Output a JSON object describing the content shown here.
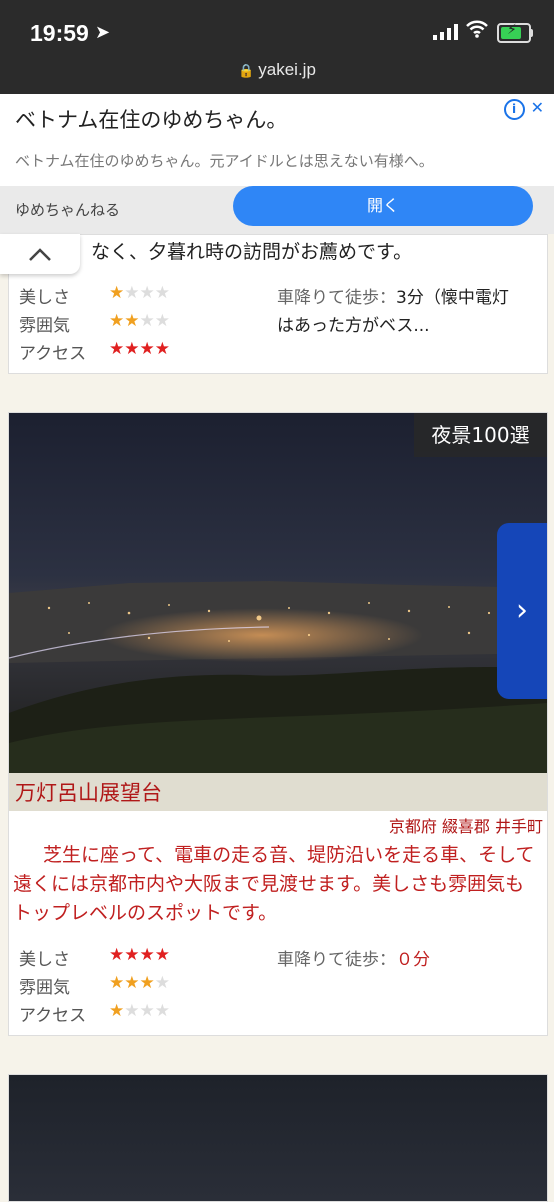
{
  "status": {
    "time": "19:59",
    "url": "yakei.jp"
  },
  "ad": {
    "title": "ベトナム在住のゆめちゃん。",
    "description": "ベトナム在住のゆめちゃん。元アイドルとは思えない有様へ。",
    "source": "ゆめちゃんねる",
    "open_label": "開く",
    "close": "✕",
    "info": "i"
  },
  "card1": {
    "text": "なく、夕暮れ時の訪問がお薦めです。",
    "ratings": [
      {
        "label": "美しさ",
        "value": 1,
        "max": 4,
        "color": "orange"
      },
      {
        "label": "雰囲気",
        "value": 2,
        "max": 4,
        "color": "orange"
      },
      {
        "label": "アクセス",
        "value": 4,
        "max": 4,
        "color": "red"
      }
    ],
    "walk_label": "車降りて徒歩：",
    "walk_value": "3分（懐中電灯",
    "walk_value2": "はあった方がベス..."
  },
  "card2": {
    "badge": "夜景100選",
    "name": "万灯呂山展望台",
    "location": "京都府 綴喜郡 井手町",
    "description": "芝生に座って、電車の走る音、堤防沿いを走る車、そして遠くには京都市内や大阪まで見渡せます。美しさも雰囲気もトップレベルのスポットです。",
    "ratings": [
      {
        "label": "美しさ",
        "value": 4,
        "max": 4,
        "color": "red"
      },
      {
        "label": "雰囲気",
        "value": 3,
        "max": 4,
        "color": "orange"
      },
      {
        "label": "アクセス",
        "value": 1,
        "max": 4,
        "color": "orange"
      }
    ],
    "walk_label": "車降りて徒歩：",
    "walk_value": "０分"
  },
  "colors": {
    "accent_red": "#c02020",
    "button_blue": "#2f86f6",
    "nav_blue": "#1546b8"
  }
}
